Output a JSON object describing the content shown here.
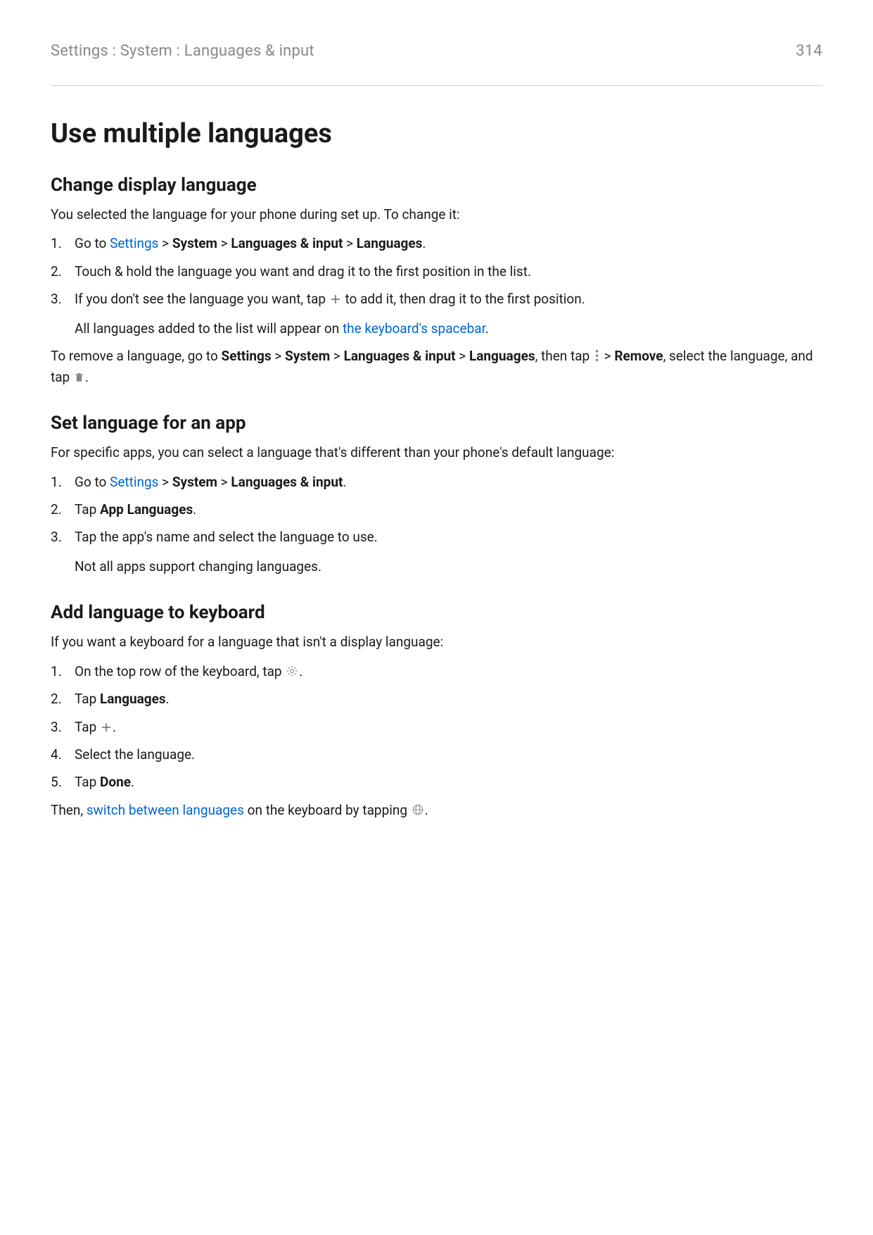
{
  "header": {
    "breadcrumb": "Settings : System : Languages & input",
    "page_number": "314"
  },
  "title": "Use multiple languages",
  "section1": {
    "heading": "Change display language",
    "intro": "You selected the language for your phone during set up. To change it:",
    "step1": {
      "pre": "Go to ",
      "link": "Settings",
      "sep1": " > ",
      "b1": "System",
      "sep2": " > ",
      "b2": "Languages & input",
      "sep3": " > ",
      "b3": "Languages",
      "end": "."
    },
    "step2": "Touch & hold the language you want and drag it to the first position in the list.",
    "step3": {
      "pre": "If you don't see the language you want, tap ",
      "post": " to add it, then drag it to the first position.",
      "sub_pre": "All languages added to the list will appear on ",
      "sub_link": "the keyboard's spacebar",
      "sub_end": "."
    },
    "remove": {
      "t1": "To remove a language, go to ",
      "b1": "Settings",
      "sep1": " > ",
      "b2": "System",
      "sep2": " > ",
      "b3": "Languages & input",
      "sep3": " > ",
      "b4": "Languages",
      "t2": ", then tap ",
      "t3": " > ",
      "b5": "Remove",
      "t4": ", select the language, and tap ",
      "t5": "."
    }
  },
  "section2": {
    "heading": "Set language for an app",
    "intro": "For specific apps, you can select a language that's different than your phone's default language:",
    "step1": {
      "pre": "Go to ",
      "link": "Settings",
      "sep1": " > ",
      "b1": "System",
      "sep2": " > ",
      "b2": "Languages & input",
      "end": "."
    },
    "step2": {
      "pre": "Tap ",
      "b1": "App Languages",
      "end": "."
    },
    "step3": {
      "line": "Tap the app's name and select the language to use.",
      "sub": "Not all apps support changing languages."
    }
  },
  "section3": {
    "heading": "Add language to keyboard",
    "intro": "If you want a keyboard for a language that isn't a display language:",
    "step1": {
      "pre": "On the top row of the keyboard, tap ",
      "end": "."
    },
    "step2": {
      "pre": "Tap ",
      "b1": "Languages",
      "end": "."
    },
    "step3": {
      "pre": "Tap ",
      "end": "."
    },
    "step4": "Select the language.",
    "step5": {
      "pre": "Tap ",
      "b1": "Done",
      "end": "."
    },
    "outro": {
      "t1": "Then, ",
      "link": "switch between languages",
      "t2": " on the keyboard by tapping ",
      "t3": "."
    }
  }
}
